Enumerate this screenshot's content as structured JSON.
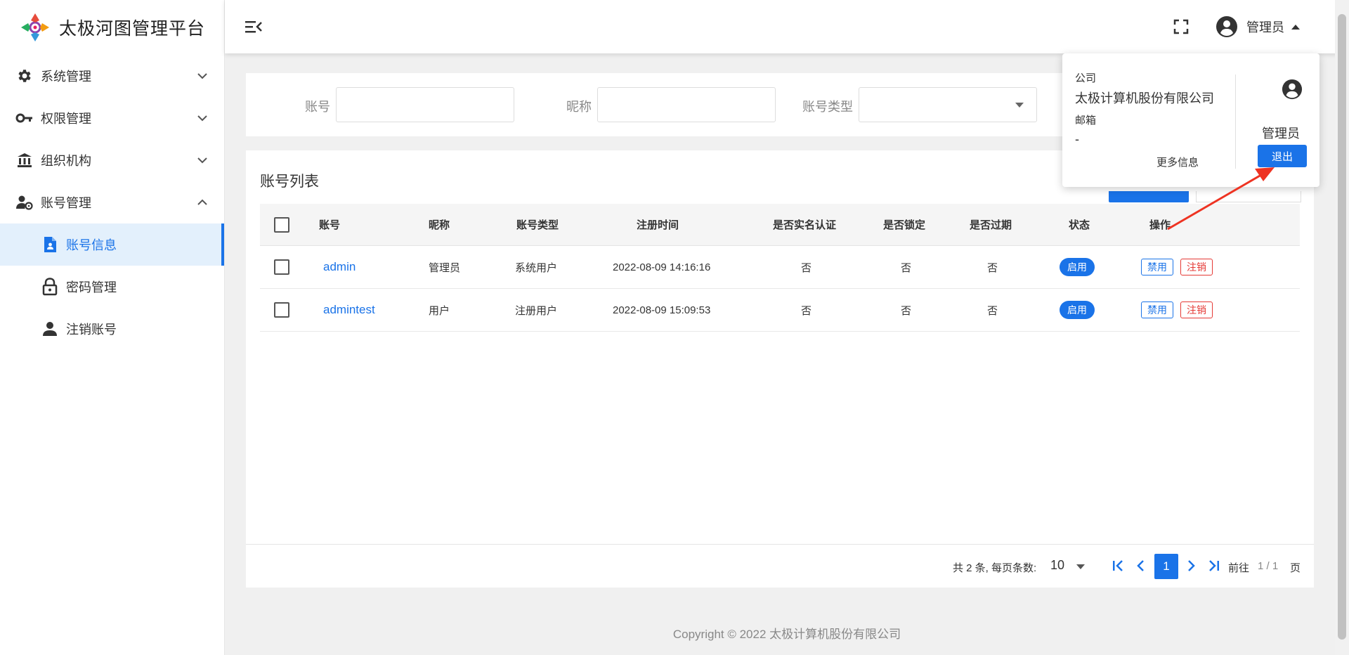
{
  "app": {
    "title": "太极河图管理平台"
  },
  "sidebar": {
    "items": [
      {
        "label": "系统管理",
        "icon": "gear-icon",
        "expanded": false
      },
      {
        "label": "权限管理",
        "icon": "key-icon",
        "expanded": false
      },
      {
        "label": "组织机构",
        "icon": "bank-icon",
        "expanded": false
      },
      {
        "label": "账号管理",
        "icon": "user-gear-icon",
        "expanded": true
      }
    ],
    "subitems": [
      {
        "label": "账号信息",
        "icon": "account-file-icon",
        "active": true
      },
      {
        "label": "密码管理",
        "icon": "lock-icon",
        "active": false
      },
      {
        "label": "注销账号",
        "icon": "person-icon",
        "active": false
      }
    ]
  },
  "header": {
    "username": "管理员"
  },
  "search": {
    "account_label": "账号",
    "nickname_label": "昵称",
    "type_label": "账号类型"
  },
  "list": {
    "title": "账号列表",
    "columns": [
      "账号",
      "昵称",
      "账号类型",
      "注册时间",
      "是否实名认证",
      "是否锁定",
      "是否过期",
      "状态",
      "操作"
    ],
    "rows": [
      {
        "account": "admin",
        "nickname": "管理员",
        "type": "系统用户",
        "registered": "2022-08-09 14:16:16",
        "verified": "否",
        "locked": "否",
        "expired": "否",
        "status": "启用",
        "action_disable": "禁用",
        "action_cancel": "注销"
      },
      {
        "account": "admintest",
        "nickname": "用户",
        "type": "注册用户",
        "registered": "2022-08-09 15:09:53",
        "verified": "否",
        "locked": "否",
        "expired": "否",
        "status": "启用",
        "action_disable": "禁用",
        "action_cancel": "注销"
      }
    ]
  },
  "pager": {
    "total_text": "共 2 条, 每页条数:",
    "page_size": "10",
    "current": "1",
    "goto": "前往",
    "pages": "1 / 1",
    "unit": "页"
  },
  "footer": {
    "copyright": "Copyright © 2022 太极计算机股份有限公司"
  },
  "user_popup": {
    "company_label": "公司",
    "company": "太极计算机股份有限公司",
    "email_label": "邮箱",
    "email": "-",
    "more": "更多信息",
    "name": "管理员",
    "logout": "退出"
  },
  "colors": {
    "primary": "#1a73e8",
    "danger": "#e53935",
    "active_bg": "#e3f0fc",
    "annotation": "#ee3322"
  }
}
